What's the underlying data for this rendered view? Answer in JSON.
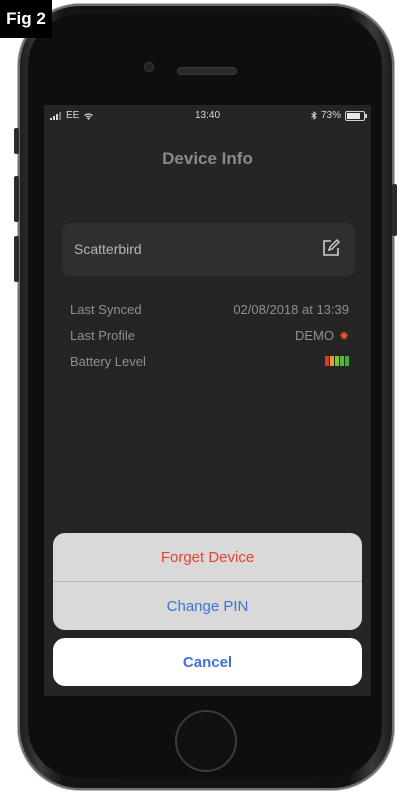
{
  "figure": {
    "label": "Fig 2"
  },
  "status_bar": {
    "carrier": "EE",
    "time": "13:40",
    "battery_percent": "73%",
    "icons": [
      "signal-icon",
      "wifi-icon",
      "bluetooth-icon",
      "battery-icon"
    ]
  },
  "nav": {
    "title": "Device Info"
  },
  "device": {
    "name": "Scatterbird",
    "edit_icon": "edit-icon"
  },
  "info": {
    "last_synced": {
      "label": "Last Synced",
      "value": "02/08/2018 at 13:39"
    },
    "last_profile": {
      "label": "Last Profile",
      "value": "DEMO",
      "icon": "star-icon",
      "icon_color": "#e0531f"
    },
    "battery_level": {
      "label": "Battery Level",
      "level": 5,
      "max": 5,
      "bar_colors": [
        "#d93a2b",
        "#e2a321",
        "#7cc242",
        "#5db83a",
        "#3fae35"
      ]
    }
  },
  "actions": {
    "forget": "Forget Device",
    "change_pin": "Change PIN",
    "cancel": "Cancel"
  },
  "colors": {
    "destructive": "#e2442f",
    "accent": "#3d73d8",
    "screen_bg": "#252525"
  }
}
